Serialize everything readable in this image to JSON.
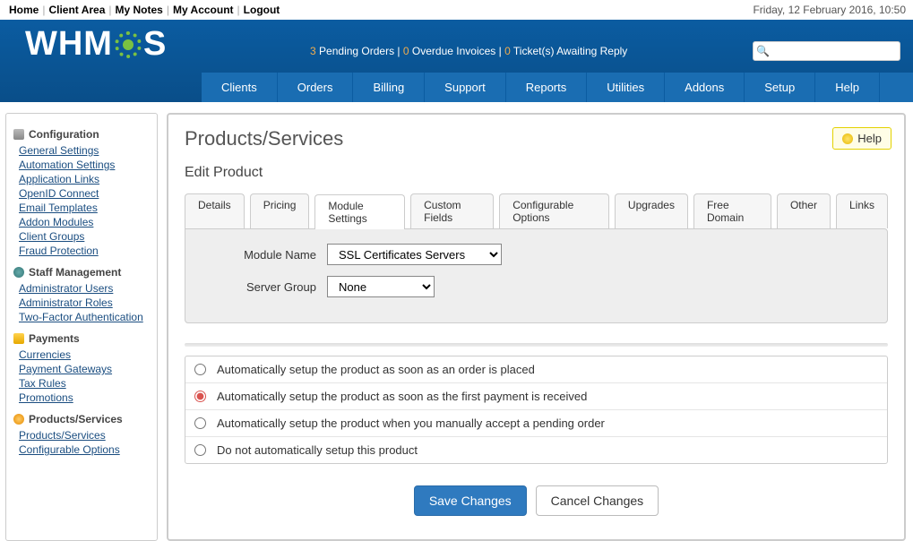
{
  "topnav": {
    "items": [
      "Home",
      "Client Area",
      "My Notes",
      "My Account",
      "Logout"
    ],
    "date": "Friday, 12 February 2016, 10:50"
  },
  "pending": {
    "orders_n": "3",
    "orders_t": "Pending Orders",
    "overdue_n": "0",
    "overdue_t": "Overdue Invoices",
    "tickets_n": "0",
    "tickets_t": "Ticket(s) Awaiting Reply"
  },
  "mainnav": [
    "Clients",
    "Orders",
    "Billing",
    "Support",
    "Reports",
    "Utilities",
    "Addons",
    "Setup",
    "Help"
  ],
  "sidebar": {
    "config_h": "Configuration",
    "config": [
      "General Settings",
      "Automation Settings",
      "Application Links",
      "OpenID Connect",
      "Email Templates",
      "Addon Modules",
      "Client Groups",
      "Fraud Protection"
    ],
    "staff_h": "Staff Management",
    "staff": [
      "Administrator Users",
      "Administrator Roles",
      "Two-Factor Authentication"
    ],
    "pay_h": "Payments",
    "pay": [
      "Currencies",
      "Payment Gateways",
      "Tax Rules",
      "Promotions"
    ],
    "prod_h": "Products/Services",
    "prod": [
      "Products/Services",
      "Configurable Options"
    ]
  },
  "page": {
    "title": "Products/Services",
    "subtitle": "Edit Product",
    "help": "Help",
    "tabs": [
      "Details",
      "Pricing",
      "Module Settings",
      "Custom Fields",
      "Configurable Options",
      "Upgrades",
      "Free Domain",
      "Other",
      "Links"
    ],
    "active_tab": 2,
    "module_label": "Module Name",
    "module_value": "SSL Certificates Servers",
    "server_label": "Server Group",
    "server_value": "None",
    "radios": [
      "Automatically setup the product as soon as an order is placed",
      "Automatically setup the product as soon as the first payment is received",
      "Automatically setup the product when you manually accept a pending order",
      "Do not automatically setup this product"
    ],
    "radio_selected": 1,
    "save": "Save Changes",
    "cancel": "Cancel Changes"
  }
}
